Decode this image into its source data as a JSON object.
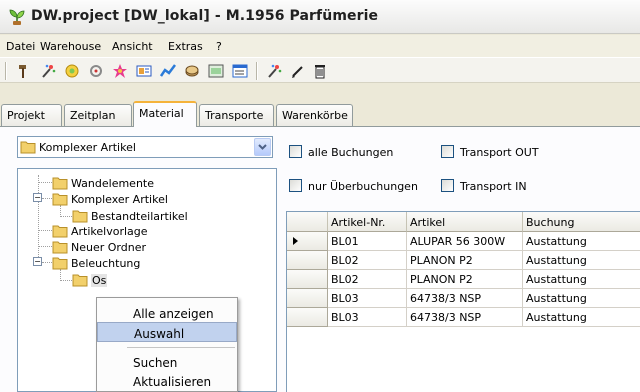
{
  "window": {
    "title": "DW.project [DW_lokal] - M.1956 Parfümerie",
    "icon": "app-plant-icon"
  },
  "menu": [
    "Datei",
    "Warehouse",
    "Ansicht",
    "Extras",
    "?"
  ],
  "toolbar": {
    "icons": [
      "hammer-icon",
      "magic-wand-icon",
      "lightbulb-star-icon",
      "tools-icon",
      "star-burst-icon",
      "card-icon",
      "chart-icon",
      "globe-disk-icon",
      "image-icon",
      "list-window-icon",
      "wand-sparkle-icon",
      "pencil-icon",
      "trash-icon"
    ]
  },
  "tabs": [
    "Projekt",
    "Zeitplan",
    "Material",
    "Transporte",
    "Warenkörbe"
  ],
  "active_tab": "Material",
  "filter": {
    "combo_value": "Komplexer Artikel",
    "checkboxes": [
      {
        "label": "alle Buchungen",
        "checked": false
      },
      {
        "label": "Transport OUT",
        "checked": false
      },
      {
        "label": "nur Überbuchungen",
        "checked": false
      },
      {
        "label": "Transport IN",
        "checked": false
      }
    ]
  },
  "tree": {
    "nodes": [
      {
        "label": "Wandelemente",
        "level": 0,
        "expander": ""
      },
      {
        "label": "Komplexer Artikel",
        "level": 0,
        "expander": "−"
      },
      {
        "label": "Bestandteilartikel",
        "level": 1,
        "expander": ""
      },
      {
        "label": "Artikelvorlage",
        "level": 0,
        "expander": ""
      },
      {
        "label": "Neuer Ordner",
        "level": 0,
        "expander": ""
      },
      {
        "label": "Beleuchtung",
        "level": 0,
        "expander": "−"
      },
      {
        "label": "Os",
        "level": 1,
        "expander": ""
      }
    ]
  },
  "context_menu": {
    "items": [
      "Alle anzeigen",
      "Auswahl",
      "Suchen",
      "Aktualisieren"
    ],
    "highlighted": "Auswahl"
  },
  "grid": {
    "columns": [
      "Artikel-Nr.",
      "Artikel",
      "Buchung"
    ],
    "rows": [
      [
        "BL01",
        "ALUPAR 56 300W",
        "Austattung"
      ],
      [
        "BL02",
        "PLANON P2",
        "Austattung"
      ],
      [
        "BL02",
        "PLANON P2",
        "Austattung"
      ],
      [
        "BL03",
        "64738/3 NSP",
        "Austattung"
      ],
      [
        "BL03",
        "64738/3 NSP",
        "Austattung"
      ]
    ],
    "current_row": 0
  },
  "colors": {
    "window_bg": "#ece9d8",
    "selection": "#c1d2ee",
    "tab_accent": "#f5b33a",
    "folder": "#f2d06b"
  }
}
